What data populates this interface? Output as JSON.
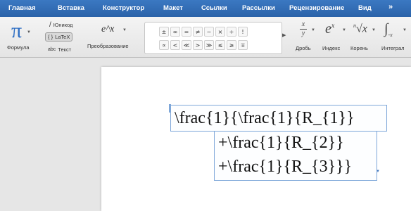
{
  "tabs": [
    "Главная",
    "Вставка",
    "Конструктор",
    "Макет",
    "Ссылки",
    "Рассылки",
    "Рецензирование",
    "Вид",
    "»"
  ],
  "ribbon": {
    "formula": {
      "icon": "π",
      "label": "Формула"
    },
    "conversion": {
      "unicode": "Юникод",
      "latex": "LaTeX",
      "text": "Текст",
      "expression": "e^x",
      "convert_label": "Преобразование"
    },
    "symbols": {
      "row1": [
        "±",
        "∞",
        "=",
        "≠",
        "~",
        "×",
        "÷",
        "!"
      ],
      "row2": [
        "∝",
        "<",
        "≪",
        ">",
        "≫",
        "≤",
        "≥",
        "∓"
      ]
    },
    "structures": [
      {
        "label": "Дробь",
        "icon": "fraction-icon"
      },
      {
        "label": "Индекс",
        "icon": "script-icon"
      },
      {
        "label": "Корень",
        "icon": "radical-icon"
      },
      {
        "label": "Интеграл",
        "icon": "integral-icon"
      }
    ]
  },
  "equation": {
    "line1": "\\frac{1}{\\frac{1}{R_{1}}",
    "line2": "+\\frac{1}{R_{2}}",
    "line3": "+\\frac{1}{R_{3}}}"
  },
  "colors": {
    "tab_bar": "#2b63a9",
    "pi": "#2f6fc4",
    "selection": "#7ea7d9"
  }
}
